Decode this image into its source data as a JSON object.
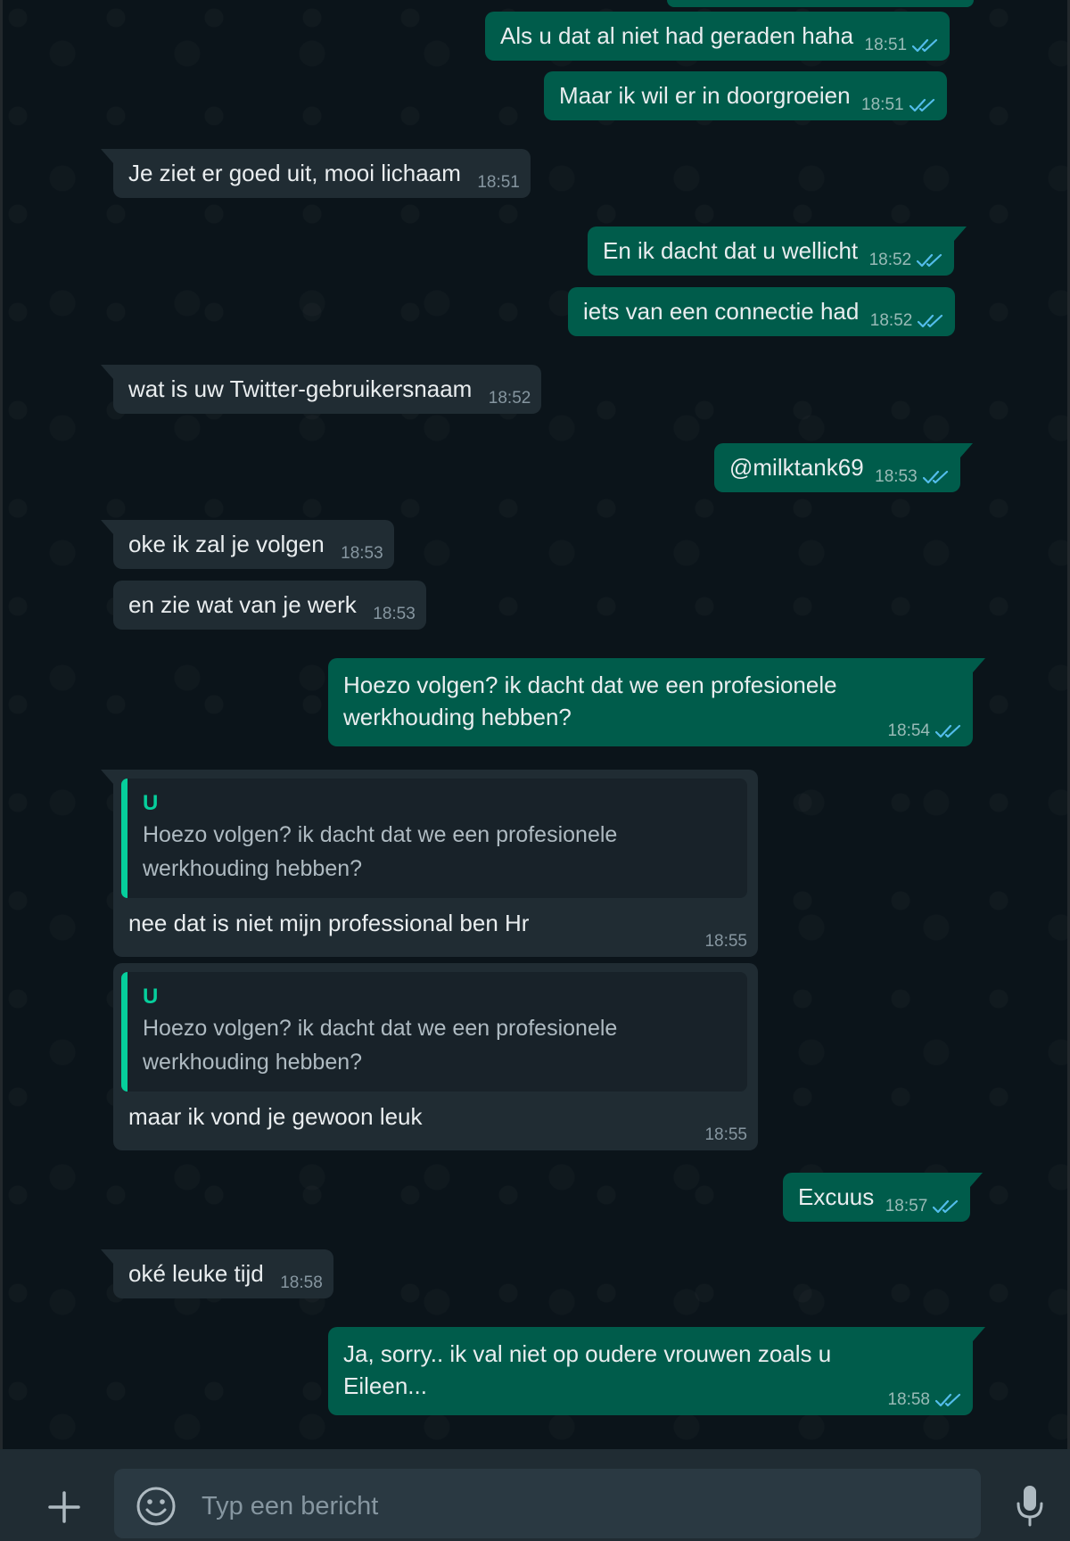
{
  "colors": {
    "background": "#0b141a",
    "outgoing_bubble": "#005c4b",
    "incoming_bubble": "#202c33",
    "quote_accent": "#06cf9c",
    "read_ticks": "#53bdeb",
    "composer": "#202c33"
  },
  "messages": [
    {
      "direction": "out",
      "text": "Als u dat al niet had geraden haha",
      "time": "18:51",
      "status": "read"
    },
    {
      "direction": "out",
      "text": "Maar ik wil er in doorgroeien",
      "time": "18:51",
      "status": "read"
    },
    {
      "direction": "in",
      "text": "Je ziet er goed uit, mooi lichaam",
      "time": "18:51"
    },
    {
      "direction": "out",
      "text": "En ik dacht dat u wellicht",
      "time": "18:52",
      "status": "read"
    },
    {
      "direction": "out",
      "text": "iets van een connectie had",
      "time": "18:52",
      "status": "read"
    },
    {
      "direction": "in",
      "text": "wat is uw Twitter-gebruikersnaam",
      "time": "18:52"
    },
    {
      "direction": "out",
      "text": "@milktank69",
      "time": "18:53",
      "status": "read"
    },
    {
      "direction": "in",
      "text": "oke ik zal je volgen",
      "time": "18:53"
    },
    {
      "direction": "in",
      "text": "en zie wat van je werk",
      "time": "18:53"
    },
    {
      "direction": "out",
      "text": "Hoezo volgen? ik dacht dat we een profesionele werkhouding hebben?",
      "time": "18:54",
      "status": "read"
    },
    {
      "direction": "in",
      "quote": {
        "author": "U",
        "text": "Hoezo volgen? ik dacht dat we een profesionele werkhouding hebben?"
      },
      "text": "nee dat is niet mijn professional ben Hr",
      "time": "18:55"
    },
    {
      "direction": "in",
      "quote": {
        "author": "U",
        "text": "Hoezo volgen? ik dacht dat we een profesionele werkhouding hebben?"
      },
      "text": "maar ik vond je gewoon leuk",
      "time": "18:55"
    },
    {
      "direction": "out",
      "text": "Excuus",
      "time": "18:57",
      "status": "read"
    },
    {
      "direction": "in",
      "text": "oké leuke tijd",
      "time": "18:58"
    },
    {
      "direction": "out",
      "text": "Ja, sorry.. ik val niet op oudere vrouwen zoals u Eileen...",
      "time": "18:58",
      "status": "read"
    }
  ],
  "composer": {
    "placeholder": "Typ een bericht",
    "attach_icon": "plus-icon",
    "emoji_icon": "emoji-icon",
    "voice_icon": "microphone-icon"
  }
}
